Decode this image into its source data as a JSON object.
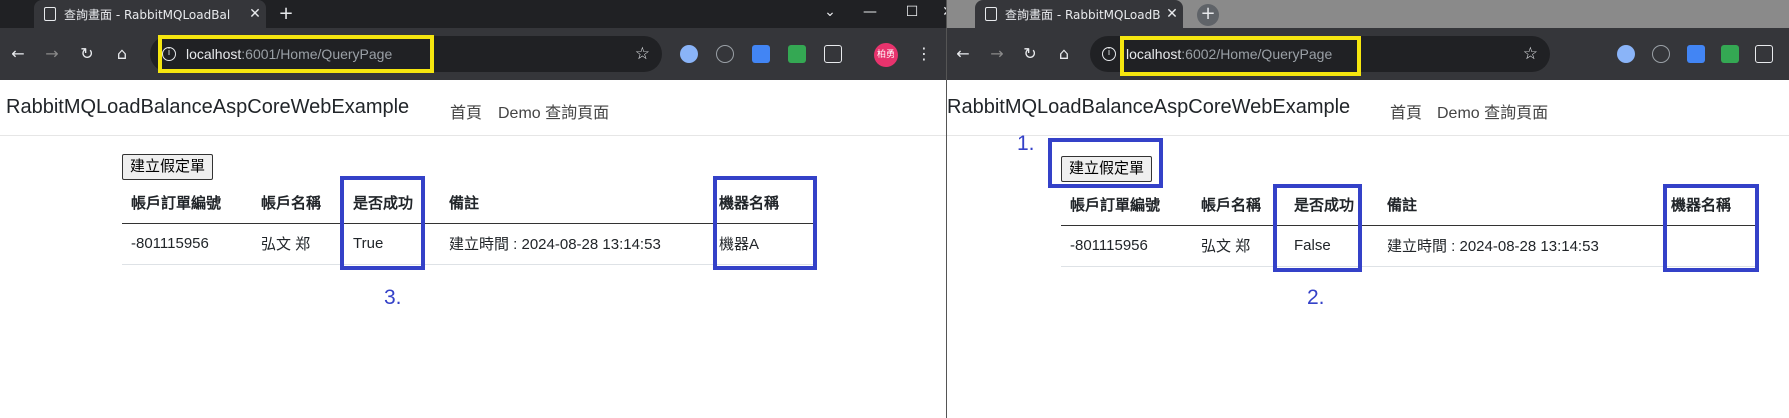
{
  "left_window": {
    "tab_title": "查詢畫面 - RabbitMQLoadBal",
    "url_host": "localhost",
    "url_rest": ":6001/Home/QueryPage",
    "profile_label": "柏勇",
    "brand": "RabbitMQLoadBalanceAspCoreWebExample",
    "nav_home": "首頁",
    "nav_demo": "Demo 查詢頁面",
    "create_button": "建立假定單",
    "columns": [
      "帳戶訂單編號",
      "帳戶名稱",
      "是否成功",
      "備註",
      "機器名稱"
    ],
    "rows": [
      [
        "-801115956",
        "弘文 郑",
        "True",
        "建立時間 : 2024-08-28 13:14:53",
        "機器A"
      ]
    ],
    "annotation": "3."
  },
  "right_window": {
    "tab_title": "查詢畫面 - RabbitMQLoadBal",
    "url_host": "localhost",
    "url_rest": ":6002/Home/QueryPage",
    "brand": "RabbitMQLoadBalanceAspCoreWebExample",
    "nav_home": "首頁",
    "nav_demo": "Demo 查詢頁面",
    "create_button": "建立假定單",
    "columns": [
      "帳戶訂單編號",
      "帳戶名稱",
      "是否成功",
      "備註",
      "機器名稱"
    ],
    "rows": [
      [
        "-801115956",
        "弘文 郑",
        "False",
        "建立時間 : 2024-08-28 13:14:53",
        ""
      ]
    ],
    "annotation_1": "1.",
    "annotation_2": "2."
  },
  "colors": {
    "annotation_blue": "#3441c8",
    "url_highlight_yellow": "#f5e60f",
    "browser_dark": "#35363a"
  },
  "icons": {
    "tab": "page-icon",
    "close": "close-icon",
    "new_tab": "plus-icon",
    "back": "back-arrow-icon",
    "forward": "forward-arrow-icon",
    "reload": "reload-icon",
    "home": "home-icon",
    "info": "site-info-icon",
    "bookmark": "star-icon"
  }
}
